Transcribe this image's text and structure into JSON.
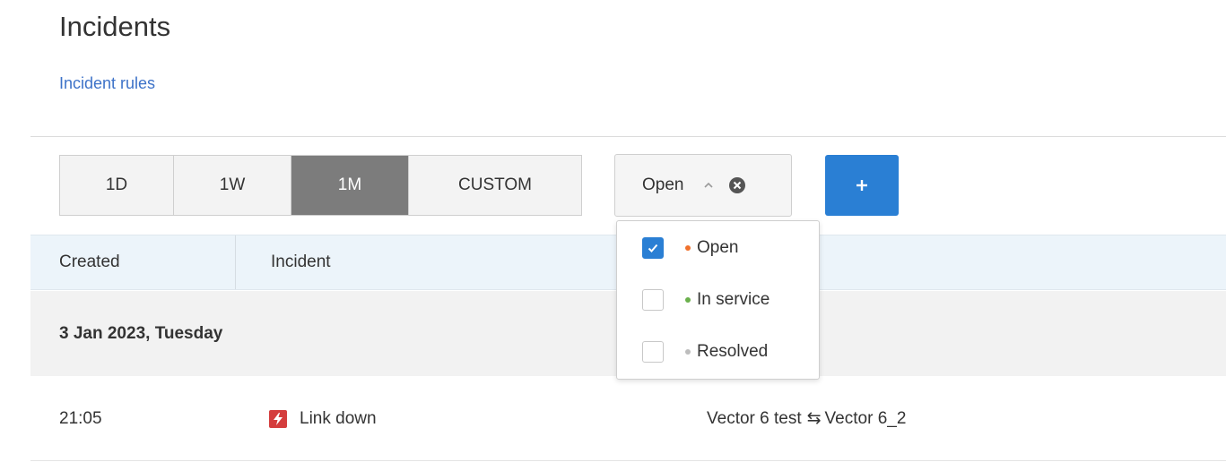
{
  "page": {
    "title": "Incidents",
    "rules_link": "Incident rules"
  },
  "period_buttons": [
    {
      "label": "1D",
      "active": false
    },
    {
      "label": "1W",
      "active": false
    },
    {
      "label": "1M",
      "active": true
    },
    {
      "label": "CUSTOM",
      "active": false
    }
  ],
  "status_filter": {
    "selected": "Open",
    "options": [
      {
        "label": "Open",
        "checked": true,
        "color": "#f0712c"
      },
      {
        "label": "In service",
        "checked": false,
        "color": "#6ab04c"
      },
      {
        "label": "Resolved",
        "checked": false,
        "color": "#bdbdbd"
      }
    ]
  },
  "add_button": {
    "label": "+"
  },
  "table": {
    "columns": [
      "Created",
      "Incident"
    ],
    "groups": [
      {
        "date": "3 Jan 2023, Tuesday",
        "rows": [
          {
            "time": "21:05",
            "incident": "Link down",
            "link_from": "Vector 6 test",
            "link_arrow": "⇆",
            "link_to": "Vector 6_2",
            "icon": "lightning-icon"
          }
        ]
      }
    ]
  },
  "colors": {
    "accent": "#2a7fd4",
    "active_segment": "#7c7c7c",
    "incident_icon": "#d43d3d",
    "link": "#3d72c8"
  }
}
